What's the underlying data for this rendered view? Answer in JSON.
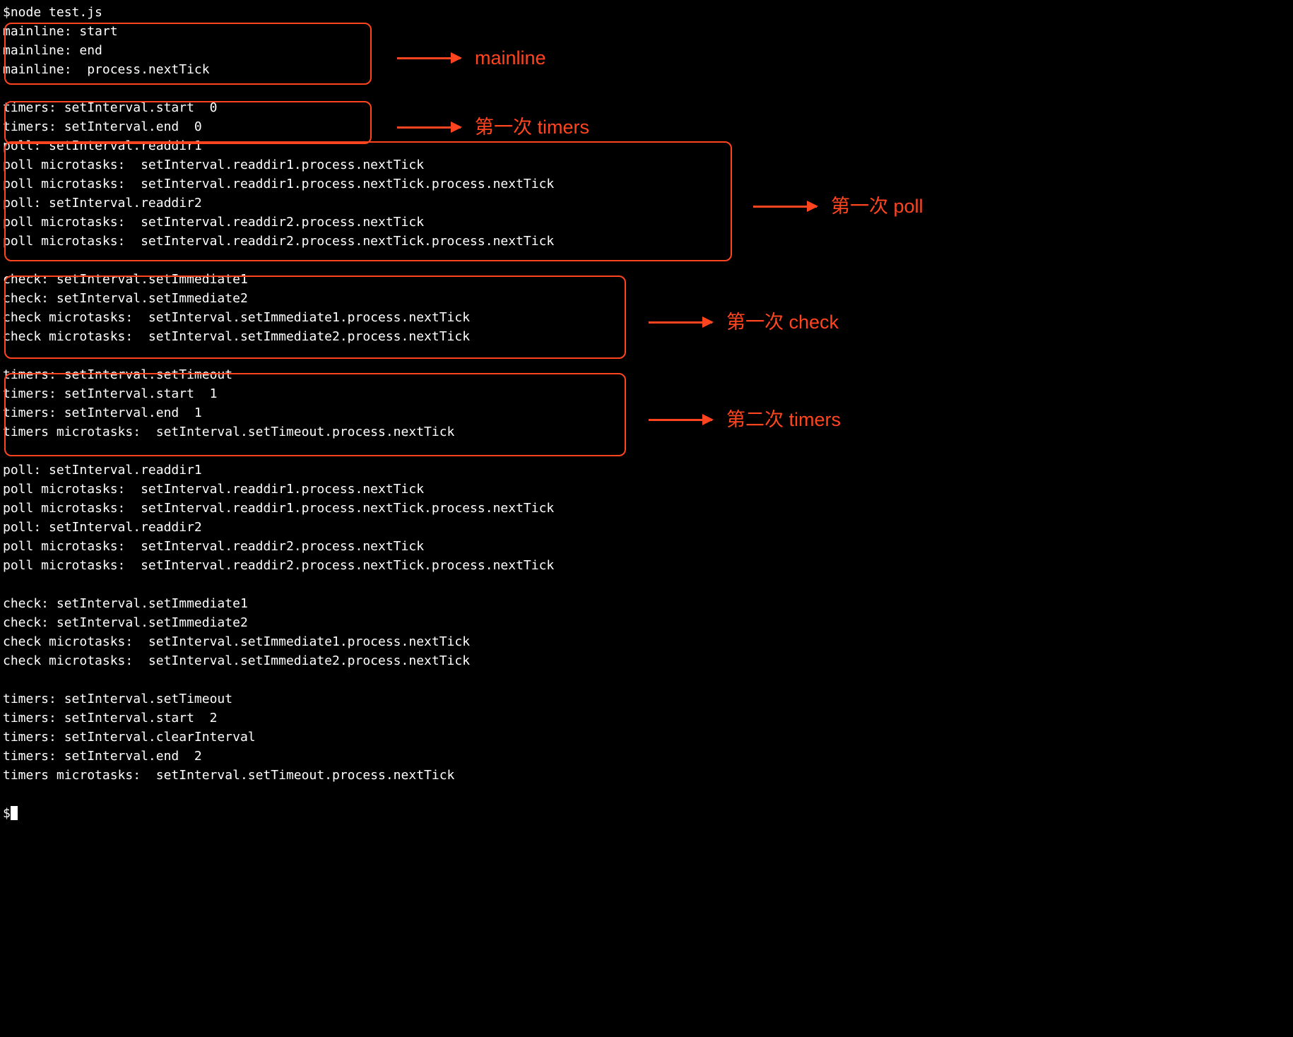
{
  "command": "$node test.js",
  "sections": {
    "mainline": {
      "lines": [
        "mainline: start",
        "mainline: end",
        "mainline:  process.nextTick"
      ],
      "label": "mainline"
    },
    "timers1": {
      "lines": [
        "timers: setInterval.start  0",
        "timers: setInterval.end  0"
      ],
      "label": "第一次 timers"
    },
    "poll1": {
      "lines": [
        "poll: setInterval.readdir1",
        "poll microtasks:  setInterval.readdir1.process.nextTick",
        "poll microtasks:  setInterval.readdir1.process.nextTick.process.nextTick",
        "poll: setInterval.readdir2",
        "poll microtasks:  setInterval.readdir2.process.nextTick",
        "poll microtasks:  setInterval.readdir2.process.nextTick.process.nextTick"
      ],
      "label": "第一次 poll"
    },
    "check1": {
      "lines": [
        "check: setInterval.setImmediate1",
        "check: setInterval.setImmediate2",
        "check microtasks:  setInterval.setImmediate1.process.nextTick",
        "check microtasks:  setInterval.setImmediate2.process.nextTick"
      ],
      "label": "第一次 check"
    },
    "timers2": {
      "lines": [
        "timers: setInterval.setTimeout",
        "timers: setInterval.start  1",
        "timers: setInterval.end  1",
        "timers microtasks:  setInterval.setTimeout.process.nextTick"
      ],
      "label": "第二次 timers"
    },
    "poll2": {
      "lines": [
        "poll: setInterval.readdir1",
        "poll microtasks:  setInterval.readdir1.process.nextTick",
        "poll microtasks:  setInterval.readdir1.process.nextTick.process.nextTick",
        "poll: setInterval.readdir2",
        "poll microtasks:  setInterval.readdir2.process.nextTick",
        "poll microtasks:  setInterval.readdir2.process.nextTick.process.nextTick"
      ]
    },
    "check2": {
      "lines": [
        "check: setInterval.setImmediate1",
        "check: setInterval.setImmediate2",
        "check microtasks:  setInterval.setImmediate1.process.nextTick",
        "check microtasks:  setInterval.setImmediate2.process.nextTick"
      ]
    },
    "timers3": {
      "lines": [
        "timers: setInterval.setTimeout",
        "timers: setInterval.start  2",
        "timers: setInterval.clearInterval",
        "timers: setInterval.end  2",
        "timers microtasks:  setInterval.setTimeout.process.nextTick"
      ]
    }
  },
  "prompt": "$"
}
